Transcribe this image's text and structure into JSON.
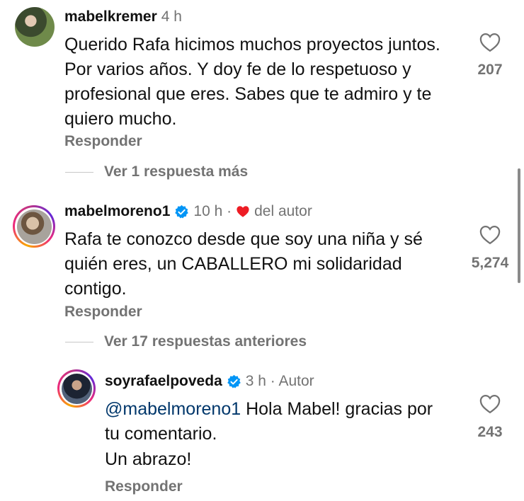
{
  "comments": [
    {
      "username": "mabelkremer",
      "meta": "4 h",
      "text": "Querido Rafa hicimos muchos proyectos juntos. Por varios años. Y doy fe de lo respetuoso y profesional que eres.  Sabes que te admiro y te quiero mucho.",
      "likes": "207",
      "reply_label": "Responder",
      "thread_label": "Ver 1 respuesta más",
      "avatar_icon": "profile-photo"
    },
    {
      "username": "mabelmoreno1",
      "verified_icon": "verified-badge-icon",
      "meta": "10 h ·",
      "author_like_label": "del autor",
      "text": "Rafa te conozco desde que soy una niña y sé quién eres, un CABALLERO mi solidaridad contigo.",
      "likes": "5,274",
      "reply_label": "Responder",
      "thread_label": "Ver 17 respuestas anteriores",
      "avatar_icon": "profile-photo-story-ring"
    },
    {
      "username": "soyrafaelpoveda",
      "verified_icon": "verified-badge-icon",
      "meta": "3 h · Autor",
      "mention": "@mabelmoreno1",
      "text_line1": " Hola Mabel! gracias por tu comentario.",
      "text_line2": "Un abrazo!",
      "likes": "243",
      "reply_label": "Responder",
      "avatar_icon": "profile-photo-story-ring"
    }
  ],
  "colors": {
    "text": "#111111",
    "secondary": "#737373",
    "mention": "#00376b",
    "verified": "#0095f6",
    "heart": "#ed1c24"
  }
}
